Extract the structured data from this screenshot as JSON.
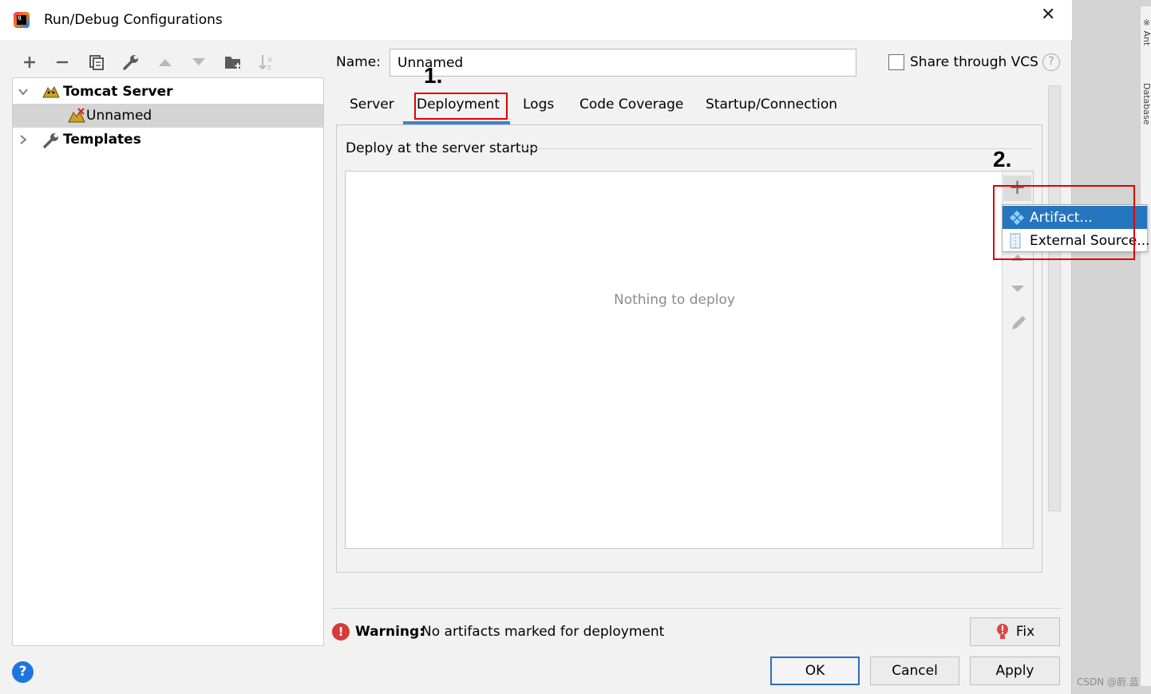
{
  "window": {
    "title": "Run/Debug Configurations",
    "close_glyph": "✕"
  },
  "toolbar": {
    "items": [
      {
        "name": "add",
        "glyph": "+"
      },
      {
        "name": "remove",
        "glyph": "−"
      },
      {
        "name": "copy",
        "glyph": ""
      },
      {
        "name": "wrench",
        "glyph": ""
      },
      {
        "name": "move-up",
        "glyph": "▲"
      },
      {
        "name": "move-down",
        "glyph": "▼"
      },
      {
        "name": "folder",
        "glyph": ""
      },
      {
        "name": "sort",
        "glyph": ""
      }
    ]
  },
  "tree": {
    "tomcat_server": "Tomcat Server",
    "unnamed": "Unnamed",
    "templates": "Templates"
  },
  "form": {
    "name_label": "Name:",
    "name_value": "Unnamed",
    "share_vcs": "Share through VCS",
    "help_glyph": "?"
  },
  "tabs": [
    "Server",
    "Deployment",
    "Logs",
    "Code Coverage",
    "Startup/Connection"
  ],
  "annotations": {
    "first": "1.",
    "second": "2."
  },
  "deployment": {
    "section_title": "Deploy at the server startup",
    "empty_text": "Nothing to deploy",
    "add_glyph": "+",
    "popup": [
      "Artifact...",
      "External Source..."
    ]
  },
  "warning": {
    "label": "Warning:",
    "message": "No artifacts marked for deployment"
  },
  "buttons": {
    "fix": "Fix",
    "ok": "OK",
    "cancel": "Cancel",
    "apply": "Apply",
    "help": "?"
  },
  "side_panel": {
    "labels": [
      "※ Ant",
      "Database"
    ]
  },
  "watermark": "CSDN @蔚.蓝",
  "colors": {
    "accent": "#4083c9",
    "selection": "#2675bf",
    "annotation_box": "#e00000"
  }
}
